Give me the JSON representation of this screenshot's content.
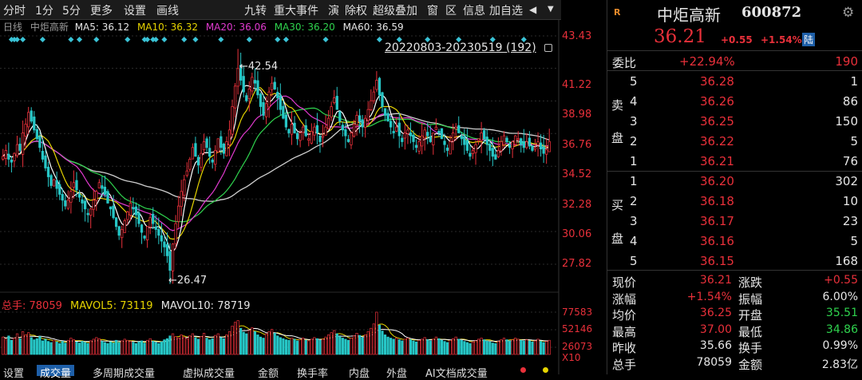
{
  "toolbar": {
    "left": [
      "分时",
      "1分",
      "5分",
      "更多",
      "设置",
      "画线"
    ],
    "right": [
      "九转",
      "重大事件",
      "演",
      "除权",
      "超级叠加",
      "窗",
      "区",
      "信息",
      "加自选"
    ],
    "arrow": "◀"
  },
  "chart_header": {
    "period": "日线",
    "name": "中炬高新",
    "ma5": "MA5: 36.12",
    "ma10": "MA10: 36.32",
    "ma20": "MA20: 36.06",
    "ma30": "MA30: 36.20",
    "ma60": "MA60: 36.59",
    "range": "20220803-20230519 (192)"
  },
  "price_axis": [
    "43.43",
    "41.22",
    "38.98",
    "36.76",
    "34.52",
    "32.28",
    "30.06",
    "27.82"
  ],
  "annotations": {
    "high": "42.54",
    "low": "26.47"
  },
  "volume_header": {
    "total": "总手: 78059",
    "mavol5": "MAVOL5: 73119",
    "mavol10": "MAVOL10: 78719"
  },
  "volume_axis": [
    "77583",
    "52146",
    "26073",
    "X10"
  ],
  "bottom_tabs": [
    "设置",
    "成交量",
    "多周期成交量",
    "虚拟成交量",
    "金额",
    "换手率",
    "内盘",
    "外盘",
    "AI文档成交量"
  ],
  "stock": {
    "badge": "R",
    "name": "中炬高新",
    "code": "600872",
    "price": "36.21",
    "change": "+0.55",
    "change_pct": "+1.54%",
    "market": "陆"
  },
  "weibi": {
    "label": "委比",
    "pct": "+22.94%",
    "diff": "190"
  },
  "sell": {
    "label": [
      "卖",
      "盘"
    ],
    "rows": [
      {
        "level": "5",
        "price": "36.28",
        "vol": "1"
      },
      {
        "level": "4",
        "price": "36.26",
        "vol": "86"
      },
      {
        "level": "3",
        "price": "36.25",
        "vol": "150"
      },
      {
        "level": "2",
        "price": "36.22",
        "vol": "5"
      },
      {
        "level": "1",
        "price": "36.21",
        "vol": "76"
      }
    ]
  },
  "buy": {
    "label": [
      "买",
      "盘"
    ],
    "rows": [
      {
        "level": "1",
        "price": "36.20",
        "vol": "302"
      },
      {
        "level": "2",
        "price": "36.18",
        "vol": "10"
      },
      {
        "level": "3",
        "price": "36.17",
        "vol": "23"
      },
      {
        "level": "4",
        "price": "36.16",
        "vol": "5"
      },
      {
        "level": "5",
        "price": "36.15",
        "vol": "168"
      }
    ]
  },
  "stats": {
    "left": [
      {
        "k": "现价",
        "v": "36.21"
      },
      {
        "k": "涨幅",
        "v": "+1.54%"
      },
      {
        "k": "均价",
        "v": "36.25"
      },
      {
        "k": "最高",
        "v": "37.00"
      },
      {
        "k": "昨收",
        "v": "35.66"
      },
      {
        "k": "总手",
        "v": "78059"
      }
    ],
    "right": [
      {
        "k": "涨跌",
        "v": "+0.55"
      },
      {
        "k": "振幅",
        "v": "6.00%"
      },
      {
        "k": "开盘",
        "v": "35.51"
      },
      {
        "k": "最低",
        "v": "34.86"
      },
      {
        "k": "换手",
        "v": "0.99%"
      },
      {
        "k": "金额",
        "v": "2.83亿"
      }
    ]
  },
  "colors": {
    "up": "#e8303a",
    "down": "#2fd34e",
    "ma5": "#ffffff",
    "ma10": "#e6d400",
    "ma20": "#e23ad0",
    "ma30": "#2fd34e",
    "ma60": "#cfcfcf"
  },
  "chart_data": {
    "type": "candlestick",
    "y_range": [
      26.47,
      43.43
    ],
    "high_label": 42.54,
    "low_label": 26.47,
    "closes": [
      35.2,
      35.6,
      35.0,
      34.8,
      35.4,
      36.0,
      35.6,
      36.8,
      37.4,
      38.2,
      37.6,
      37.0,
      36.4,
      35.8,
      35.0,
      34.4,
      33.8,
      33.2,
      33.6,
      33.0,
      32.6,
      32.2,
      31.8,
      32.2,
      32.8,
      33.4,
      32.9,
      32.4,
      32.0,
      31.6,
      31.2,
      31.6,
      32.2,
      32.8,
      33.4,
      33.0,
      32.6,
      32.0,
      31.6,
      31.0,
      30.4,
      29.8,
      30.2,
      30.8,
      31.4,
      32.0,
      31.6,
      31.2,
      30.6,
      30.0,
      29.6,
      30.4,
      31.0,
      30.6,
      30.2,
      29.8,
      29.4,
      29.0,
      28.4,
      27.4,
      29.2,
      30.6,
      31.8,
      32.8,
      33.6,
      34.2,
      35.0,
      35.8,
      35.2,
      34.6,
      35.4,
      36.2,
      35.8,
      35.2,
      34.8,
      35.6,
      36.4,
      35.8,
      35.4,
      36.2,
      37.0,
      38.6,
      40.0,
      41.2,
      40.4,
      39.6,
      39.0,
      39.8,
      40.6,
      40.2,
      39.4,
      38.6,
      38.0,
      38.8,
      39.6,
      40.2,
      39.8,
      39.2,
      38.4,
      37.8,
      37.2,
      36.8,
      37.4,
      36.8,
      36.4,
      36.8,
      37.2,
      36.6,
      36.4,
      36.9,
      37.2,
      36.8,
      36.2,
      36.6,
      37.2,
      37.8,
      38.6,
      39.2,
      38.4,
      37.6,
      37.0,
      36.6,
      36.2,
      36.8,
      37.4,
      38.0,
      37.6,
      37.2,
      37.8,
      38.4,
      39.0,
      39.6,
      40.4,
      39.4,
      38.6,
      38.0,
      37.6,
      37.2,
      36.8,
      37.2,
      36.6,
      36.2,
      36.8,
      37.0,
      36.6,
      36.2,
      35.8,
      36.2,
      36.6,
      37.0,
      36.6,
      36.2,
      36.8,
      37.2,
      36.8,
      36.4,
      36.0,
      35.6,
      36.2,
      36.8,
      37.2,
      36.8,
      36.4,
      36.0,
      35.6,
      35.2,
      35.6,
      36.0,
      36.4,
      36.8,
      36.4,
      36.0,
      35.6,
      35.2,
      35.0,
      35.6,
      36.2,
      36.6,
      36.2,
      35.8,
      36.2,
      36.6,
      36.4,
      36.0,
      35.8,
      36.2,
      35.9,
      35.6,
      35.8,
      36.2,
      35.7,
      35.4,
      35.66,
      36.21
    ],
    "volumes": [
      3.2,
      2.8,
      3.4,
      2.6,
      3.0,
      3.8,
      2.9,
      4.2,
      3.6,
      4.0,
      3.1,
      2.7,
      2.9,
      3.3,
      2.5,
      2.8,
      2.4,
      2.2,
      2.6,
      2.3,
      2.0,
      2.4,
      2.1,
      2.6,
      3.0,
      2.7,
      2.3,
      2.1,
      2.4,
      2.2,
      2.0,
      2.5,
      2.8,
      3.1,
      2.9,
      2.4,
      2.2,
      2.0,
      2.3,
      2.1,
      2.6,
      2.2,
      2.5,
      2.8,
      2.6,
      2.4,
      2.2,
      2.0,
      2.3,
      2.5,
      2.1,
      2.6,
      2.9,
      2.4,
      2.2,
      2.0,
      2.3,
      2.7,
      2.9,
      3.4,
      3.8,
      3.3,
      3.0,
      3.6,
      3.2,
      2.9,
      3.4,
      3.8,
      3.1,
      2.8,
      3.3,
      3.9,
      3.0,
      2.7,
      2.9,
      3.5,
      3.8,
      3.1,
      2.9,
      3.6,
      4.2,
      5.2,
      5.9,
      6.2,
      4.8,
      4.1,
      3.8,
      4.4,
      4.9,
      4.2,
      3.6,
      3.2,
      3.0,
      3.8,
      4.2,
      4.6,
      3.9,
      3.4,
      3.1,
      2.9,
      2.7,
      2.6,
      3.0,
      2.8,
      2.5,
      2.7,
      3.0,
      2.6,
      2.5,
      2.8,
      3.1,
      2.9,
      2.6,
      2.8,
      3.2,
      3.6,
      4.0,
      4.4,
      3.8,
      3.3,
      3.0,
      2.8,
      2.6,
      3.0,
      3.4,
      3.9,
      3.5,
      3.1,
      3.6,
      4.2,
      4.8,
      5.6,
      7.76,
      5.4,
      4.3,
      3.6,
      3.2,
      3.0,
      2.8,
      3.0,
      2.7,
      2.5,
      2.8,
      3.0,
      2.7,
      2.5,
      2.3,
      2.6,
      2.8,
      3.1,
      2.7,
      2.5,
      2.8,
      3.2,
      2.9,
      2.6,
      2.4,
      2.2,
      2.6,
      2.9,
      3.2,
      2.8,
      2.6,
      2.4,
      2.2,
      2.0,
      2.3,
      2.5,
      2.8,
      3.0,
      2.7,
      2.5,
      2.3,
      2.1,
      2.0,
      2.4,
      2.7,
      3.0,
      2.7,
      2.5,
      2.7,
      3.0,
      2.8,
      2.6,
      2.5,
      2.7,
      2.5,
      2.3,
      2.5,
      2.8,
      2.4,
      2.2,
      2.4,
      2.6
    ],
    "volume_axis_max": 77583
  }
}
